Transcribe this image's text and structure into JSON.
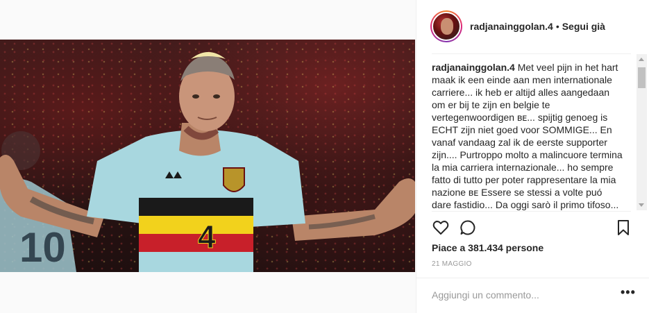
{
  "post": {
    "photo_alt": "",
    "jersey_number": "4"
  },
  "header": {
    "username": "radjanainggolan.4",
    "separator": "•",
    "follow_label": "Segui già"
  },
  "caption": {
    "username": "radjanainggolan.4",
    "text": "Met veel pijn in het hart maak ik een einde aan men internationale carriere... ik heb er altijd alles aangedaan om er bij te zijn en belgie te vertegenwoordigen ʙᴇ... spijtig genoeg is ECHT zijn niet goed voor SOMMIGE... En vanaf vandaag zal ik de eerste supporter zijn.... Purtroppo molto a malincuore termina la mia carriera internazionale... ho sempre fatto di tutto per poter rappresentare la mia nazione ʙᴇ Essere se stessi a volte puó dare fastidio... Da oggi sarò il primo tifoso..."
  },
  "actions": {
    "like_icon": "heart-icon",
    "comment_icon": "comment-bubble-icon",
    "save_icon": "bookmark-icon"
  },
  "likes": {
    "prefix": "Piace a ",
    "count": "381.434",
    "suffix": " persone"
  },
  "date": "21 MAGGIO",
  "comment": {
    "placeholder": "Aggiungi un commento...",
    "more_label": "•••"
  }
}
